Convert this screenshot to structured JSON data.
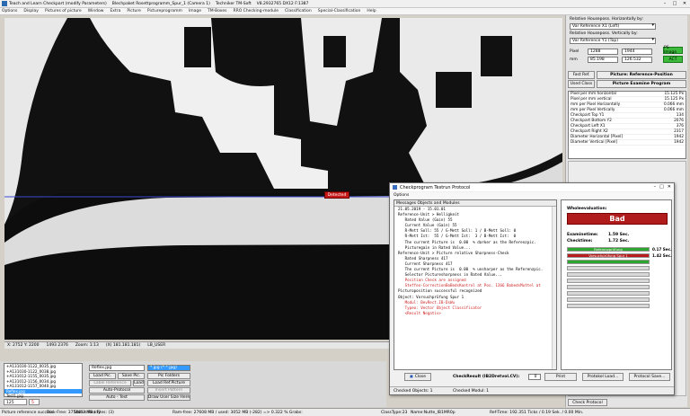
{
  "titlebar": {
    "segments": [
      "Teach and Learn Checkpart (modify Parameters)",
      "Blechpaket Rosettprogramm_Spur_1  (Camera 1)",
      "Techniker TM-Soft",
      "V8.2932765 DX12 F:1387"
    ],
    "minimize": "–",
    "maximize": "□",
    "close": "✕"
  },
  "menubar": {
    "items": [
      "Options",
      "Display",
      "Pictures of picture",
      "Window",
      "Extra",
      "Picture",
      "Pictureprogramm",
      "Image",
      "TM-Boxes",
      "RRO Checking-module",
      "Classification",
      "Special-Classification",
      "Help"
    ]
  },
  "image": {
    "tag_label": "Detected",
    "footer": [
      "X: 2752  Y: 2200",
      "1493  2376",
      "Zoom: 1:13",
      "(X) 181.181.181)",
      "LB_USER"
    ]
  },
  "right_panel": {
    "h_label": "Relative Houseposs. Horizontally by:",
    "h_select": "Var Reference X1 (Left)",
    "v_label": "Relative Houseposs. Vertically by:",
    "v_select": "Var Reference Y1 (Top)",
    "pos_label": "Pixel",
    "x1": "1288",
    "x2": "1944",
    "y1": "85.198",
    "y2": "126.532",
    "mm_label": "mm",
    "ps_btn": "PS Image",
    "act_btn": "ACT",
    "fast_ref": "Fast Ref.",
    "picture_ref": "Picture: Reference-Position",
    "used_class": "Used Class",
    "picture_exam": "Picture Examine Program",
    "props": [
      {
        "k": "Pixel per mm horizontal",
        "v": "15.125 Px"
      },
      {
        "k": "Pixel per mm vertical",
        "v": "15.125 Px"
      },
      {
        "k": "mm per Pixel Horizontally",
        "v": "0.066 mm"
      },
      {
        "k": "mm per Pixel Vertically",
        "v": "0.066 mm"
      },
      {
        "k": "Checkpart Top Y1",
        "v": "134"
      },
      {
        "k": "Checkpart Bottom Y2",
        "v": "2076"
      },
      {
        "k": "Checkpart Left X1",
        "v": "376"
      },
      {
        "k": "Checkpart Right X2",
        "v": "2317"
      },
      {
        "k": "Diameter Horizontal [Pixel]",
        "v": "1942"
      },
      {
        "k": "Diameter Vertical [Pixel]",
        "v": "1942"
      }
    ],
    "check_protocol": "Check Protocol"
  },
  "files": {
    "list": [
      "+A131030-1122_0035.jpg",
      "+A131030-1122_0038.jpg",
      "+A131012-1155_0035.jpg",
      "+A131012-1156_0034.jpg",
      "+A131012-1157_0040.jpg",
      "Reflex.jpg",
      "Test1.jpg"
    ],
    "selected_index": 5,
    "count": "125",
    "index": "5",
    "current": "Reflex.jpg",
    "filter": "*.jpg (*.*.jpg)",
    "load_pic": "Load Pic.",
    "save_pic": "Save Pic.",
    "label_reference": "Label Reference",
    "load": "Load",
    "auto_protocol": "Auto-Protocol",
    "auto_test": "Auto - Test",
    "pic_folders": "Pic Folders",
    "load_ref_picture": "Load Ref.Picture",
    "insert_pattern": "Insert Pattern",
    "draw_user": "Draw User Size Here",
    "status_left": "Picture reference success",
    "disk_free": "Disk-Free: 37586?? MB  / Files: (3)"
  },
  "statusbar": {
    "ready": "Status:Ready",
    "mem": "Ram-free: 27608 MB / used: 3052 MB (-282) => 0.322 % Grabs:",
    "classtype": "ClassType:23",
    "name": "Name:Nutte_IB1MR0p",
    "time": "Ref-Time: 192.351 Ticks / 0.19 Sek. / 0.00 Min."
  },
  "dialog": {
    "title": "Checkprogram Testrun Protocol",
    "menu": "Options",
    "log_header": "Messages Objects and Modules",
    "log": [
      {
        "t": "21.05.2019 - 15.01.01",
        "red": false
      },
      {
        "t": "Reference-Unit > Helligkeit",
        "red": false
      },
      {
        "t": "   Rated Value (Gain) 55",
        "red": false
      },
      {
        "t": "   Current Value (Gain) 55",
        "red": false
      },
      {
        "t": "   R-Mett Soll: 55 / G-Mett Soll: 1 / B-Mett Soll: 0",
        "red": false
      },
      {
        "t": "   R-Mett Ist:  55 / G-Mett Ist:  3 / B-Mett Ist:  0",
        "red": false
      },
      {
        "t": "   The current Picture is  0.00  % darker as the Referenzpic.",
        "red": false
      },
      {
        "t": "   Picturegain in Rated Value...",
        "red": false
      },
      {
        "t": "",
        "red": false
      },
      {
        "t": "Reference-Unit > Picture relative Sharpness-Check",
        "red": false
      },
      {
        "t": "   Rated Sharpness 417",
        "red": false
      },
      {
        "t": "   Current Sharpness 417",
        "red": false
      },
      {
        "t": "   The current Picture is  0.00  % unsharper as the Referenzpic.",
        "red": false
      },
      {
        "t": "   Selector Picturesharpness in Rated Value...",
        "red": false
      },
      {
        "t": "",
        "red": false
      },
      {
        "t": "   Position Check are assigned",
        "red": true
      },
      {
        "t": "   Steffen-CorrectionBoBedsKontrol at Pos. 1366 BobedsMuttel at",
        "red": true
      },
      {
        "t": "Picturoposition successful recognized",
        "red": false
      },
      {
        "t": "",
        "red": false
      },
      {
        "t": "",
        "red": false
      },
      {
        "t": "Object: Vorsuchprüfung Spur 1",
        "red": false
      },
      {
        "t": "   Modul: BevRect.IB-DsWu",
        "red": true
      },
      {
        "t": "",
        "red": false
      },
      {
        "t": "   Typeo: Vector Object Classificator",
        "red": true
      },
      {
        "t": "   <Result Negativ>",
        "red": true
      }
    ],
    "eval_title": "Wholeevaluation:",
    "result": "Bad",
    "examine_label": "Examinetime:",
    "examine_value": "1.59 Sec.",
    "check_label": "Checktime:",
    "check_value": "1.72 Sec.",
    "bars": [
      {
        "label": "Referenzprüfung",
        "kind": "green",
        "sec": "0.17 Sec."
      },
      {
        "label": "Vorsuchprüfung Spur 1",
        "kind": "red",
        "sec": "1.42 Sec."
      },
      {
        "label": "",
        "kind": "green",
        "sec": ""
      },
      {
        "label": "",
        "kind": "grey",
        "sec": ""
      },
      {
        "label": "",
        "kind": "grey",
        "sec": ""
      },
      {
        "label": "",
        "kind": "grey",
        "sec": ""
      },
      {
        "label": "",
        "kind": "grey",
        "sec": ""
      },
      {
        "label": "",
        "kind": "grey",
        "sec": ""
      },
      {
        "label": "",
        "kind": "grey",
        "sec": ""
      },
      {
        "label": "",
        "kind": "grey",
        "sec": ""
      }
    ],
    "close_btn": "Close",
    "check_result": "CheckResult (IB2Dretvol.CV):",
    "check_result_val": "0",
    "print_btn": "Print",
    "protocol_load": "Protokol Load...",
    "protocol_save": "Protocol Save...",
    "checked_objects": "Checked Objects: 1",
    "checked_modules": "Checked Modul: 1"
  },
  "colors": {
    "bad": "#b01c1c",
    "ok": "#2ea52e",
    "selection": "#3399ff"
  }
}
